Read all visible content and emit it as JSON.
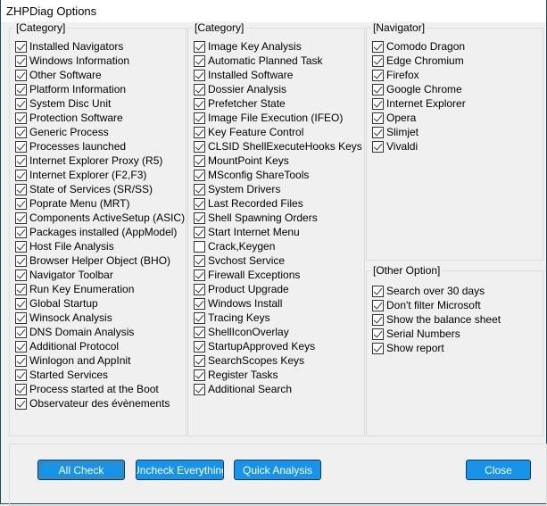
{
  "title": "ZHPDiag Options",
  "groups": {
    "cat1": {
      "label": "[Category]",
      "items": [
        {
          "label": "Installed Navigators",
          "checked": true
        },
        {
          "label": "Windows Information",
          "checked": true
        },
        {
          "label": "Other Software",
          "checked": true
        },
        {
          "label": "Platform Information",
          "checked": true
        },
        {
          "label": "System Disc Unit",
          "checked": true
        },
        {
          "label": "Protection Software",
          "checked": true
        },
        {
          "label": "Generic Process",
          "checked": true
        },
        {
          "label": "Processes launched",
          "checked": true
        },
        {
          "label": "Internet Explorer Proxy (R5)",
          "checked": true
        },
        {
          "label": "Internet Explorer (F2,F3)",
          "checked": true
        },
        {
          "label": "State of Services (SR/SS)",
          "checked": true
        },
        {
          "label": "Poprate Menu (MRT)",
          "checked": true
        },
        {
          "label": "Components ActiveSetup (ASIC)",
          "checked": true
        },
        {
          "label": "Packages installed (AppModel)",
          "checked": true
        },
        {
          "label": "Host File Analysis",
          "checked": true
        },
        {
          "label": "Browser Helper Object (BHO)",
          "checked": true
        },
        {
          "label": "Navigator Toolbar",
          "checked": true
        },
        {
          "label": "Run Key Enumeration",
          "checked": true
        },
        {
          "label": "Global Startup",
          "checked": true
        },
        {
          "label": "Winsock Analysis",
          "checked": true
        },
        {
          "label": "DNS Domain Analysis",
          "checked": true
        },
        {
          "label": "Additional Protocol",
          "checked": true
        },
        {
          "label": "Winlogon and AppInit",
          "checked": true
        },
        {
          "label": "Started Services",
          "checked": true
        },
        {
          "label": "Process started at the Boot",
          "checked": true
        },
        {
          "label": "Observateur des évènements",
          "checked": true
        }
      ]
    },
    "cat2": {
      "label": "[Category]",
      "items": [
        {
          "label": "Image Key Analysis",
          "checked": true
        },
        {
          "label": "Automatic Planned Task",
          "checked": true
        },
        {
          "label": "Installed Software",
          "checked": true
        },
        {
          "label": "Dossier Analysis",
          "checked": true
        },
        {
          "label": "Prefetcher State",
          "checked": true
        },
        {
          "label": "Image File Execution (IFEO)",
          "checked": true
        },
        {
          "label": "Key Feature Control",
          "checked": true
        },
        {
          "label": "CLSID ShellExecuteHooks Keys",
          "checked": true
        },
        {
          "label": "MountPoint Keys",
          "checked": true
        },
        {
          "label": "MSconfig ShareTools",
          "checked": true
        },
        {
          "label": "System Drivers",
          "checked": true
        },
        {
          "label": "Last Recorded Files",
          "checked": true
        },
        {
          "label": "Shell Spawning Orders",
          "checked": true
        },
        {
          "label": "Start Internet Menu",
          "checked": true
        },
        {
          "label": "Crack,Keygen",
          "checked": false
        },
        {
          "label": "Svchost Service",
          "checked": true
        },
        {
          "label": "Firewall Exceptions",
          "checked": true
        },
        {
          "label": "Product Upgrade",
          "checked": true
        },
        {
          "label": "Windows Install",
          "checked": true
        },
        {
          "label": "Tracing Keys",
          "checked": true
        },
        {
          "label": "ShellIconOverlay",
          "checked": true
        },
        {
          "label": "StartupApproved Keys",
          "checked": true
        },
        {
          "label": "SearchScopes Keys",
          "checked": true
        },
        {
          "label": "Register Tasks",
          "checked": true
        },
        {
          "label": "Additional Search",
          "checked": true
        }
      ]
    },
    "nav": {
      "label": "[Navigator]",
      "items": [
        {
          "label": "Comodo Dragon",
          "checked": true
        },
        {
          "label": "Edge Chromium",
          "checked": true
        },
        {
          "label": "Firefox",
          "checked": true
        },
        {
          "label": "Google Chrome",
          "checked": true
        },
        {
          "label": "Internet Explorer",
          "checked": true
        },
        {
          "label": "Opera",
          "checked": true
        },
        {
          "label": "Slimjet",
          "checked": true
        },
        {
          "label": "Vivaldi",
          "checked": true
        }
      ]
    },
    "other": {
      "label": "[Other Option]",
      "items": [
        {
          "label": "Search over 30 days",
          "checked": true
        },
        {
          "label": "Don't filter Microsoft",
          "checked": true
        },
        {
          "label": "Show the balance sheet",
          "checked": true
        },
        {
          "label": "Serial Numbers",
          "checked": true
        },
        {
          "label": "Show report",
          "checked": true
        }
      ]
    }
  },
  "buttons": {
    "all_check": "All Check",
    "uncheck": "Uncheck Everything",
    "quick": "Quick Analysis",
    "close": "Close"
  },
  "colors": {
    "button": "#1793ea"
  }
}
